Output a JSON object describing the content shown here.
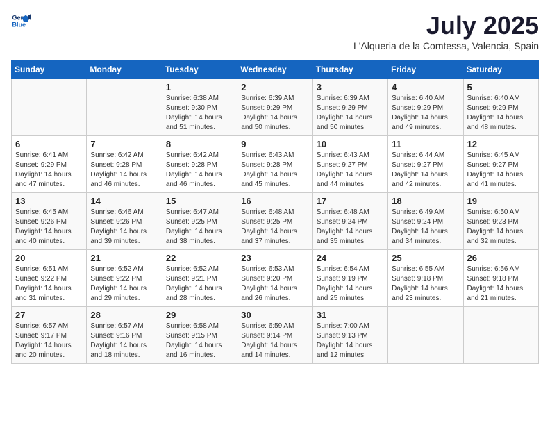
{
  "header": {
    "logo_line1": "General",
    "logo_line2": "Blue",
    "month": "July 2025",
    "location": "L'Alqueria de la Comtessa, Valencia, Spain"
  },
  "days_of_week": [
    "Sunday",
    "Monday",
    "Tuesday",
    "Wednesday",
    "Thursday",
    "Friday",
    "Saturday"
  ],
  "weeks": [
    [
      {
        "day": "",
        "info": ""
      },
      {
        "day": "",
        "info": ""
      },
      {
        "day": "1",
        "info": "Sunrise: 6:38 AM\nSunset: 9:30 PM\nDaylight: 14 hours\nand 51 minutes."
      },
      {
        "day": "2",
        "info": "Sunrise: 6:39 AM\nSunset: 9:29 PM\nDaylight: 14 hours\nand 50 minutes."
      },
      {
        "day": "3",
        "info": "Sunrise: 6:39 AM\nSunset: 9:29 PM\nDaylight: 14 hours\nand 50 minutes."
      },
      {
        "day": "4",
        "info": "Sunrise: 6:40 AM\nSunset: 9:29 PM\nDaylight: 14 hours\nand 49 minutes."
      },
      {
        "day": "5",
        "info": "Sunrise: 6:40 AM\nSunset: 9:29 PM\nDaylight: 14 hours\nand 48 minutes."
      }
    ],
    [
      {
        "day": "6",
        "info": "Sunrise: 6:41 AM\nSunset: 9:29 PM\nDaylight: 14 hours\nand 47 minutes."
      },
      {
        "day": "7",
        "info": "Sunrise: 6:42 AM\nSunset: 9:28 PM\nDaylight: 14 hours\nand 46 minutes."
      },
      {
        "day": "8",
        "info": "Sunrise: 6:42 AM\nSunset: 9:28 PM\nDaylight: 14 hours\nand 46 minutes."
      },
      {
        "day": "9",
        "info": "Sunrise: 6:43 AM\nSunset: 9:28 PM\nDaylight: 14 hours\nand 45 minutes."
      },
      {
        "day": "10",
        "info": "Sunrise: 6:43 AM\nSunset: 9:27 PM\nDaylight: 14 hours\nand 44 minutes."
      },
      {
        "day": "11",
        "info": "Sunrise: 6:44 AM\nSunset: 9:27 PM\nDaylight: 14 hours\nand 42 minutes."
      },
      {
        "day": "12",
        "info": "Sunrise: 6:45 AM\nSunset: 9:27 PM\nDaylight: 14 hours\nand 41 minutes."
      }
    ],
    [
      {
        "day": "13",
        "info": "Sunrise: 6:45 AM\nSunset: 9:26 PM\nDaylight: 14 hours\nand 40 minutes."
      },
      {
        "day": "14",
        "info": "Sunrise: 6:46 AM\nSunset: 9:26 PM\nDaylight: 14 hours\nand 39 minutes."
      },
      {
        "day": "15",
        "info": "Sunrise: 6:47 AM\nSunset: 9:25 PM\nDaylight: 14 hours\nand 38 minutes."
      },
      {
        "day": "16",
        "info": "Sunrise: 6:48 AM\nSunset: 9:25 PM\nDaylight: 14 hours\nand 37 minutes."
      },
      {
        "day": "17",
        "info": "Sunrise: 6:48 AM\nSunset: 9:24 PM\nDaylight: 14 hours\nand 35 minutes."
      },
      {
        "day": "18",
        "info": "Sunrise: 6:49 AM\nSunset: 9:24 PM\nDaylight: 14 hours\nand 34 minutes."
      },
      {
        "day": "19",
        "info": "Sunrise: 6:50 AM\nSunset: 9:23 PM\nDaylight: 14 hours\nand 32 minutes."
      }
    ],
    [
      {
        "day": "20",
        "info": "Sunrise: 6:51 AM\nSunset: 9:22 PM\nDaylight: 14 hours\nand 31 minutes."
      },
      {
        "day": "21",
        "info": "Sunrise: 6:52 AM\nSunset: 9:22 PM\nDaylight: 14 hours\nand 29 minutes."
      },
      {
        "day": "22",
        "info": "Sunrise: 6:52 AM\nSunset: 9:21 PM\nDaylight: 14 hours\nand 28 minutes."
      },
      {
        "day": "23",
        "info": "Sunrise: 6:53 AM\nSunset: 9:20 PM\nDaylight: 14 hours\nand 26 minutes."
      },
      {
        "day": "24",
        "info": "Sunrise: 6:54 AM\nSunset: 9:19 PM\nDaylight: 14 hours\nand 25 minutes."
      },
      {
        "day": "25",
        "info": "Sunrise: 6:55 AM\nSunset: 9:18 PM\nDaylight: 14 hours\nand 23 minutes."
      },
      {
        "day": "26",
        "info": "Sunrise: 6:56 AM\nSunset: 9:18 PM\nDaylight: 14 hours\nand 21 minutes."
      }
    ],
    [
      {
        "day": "27",
        "info": "Sunrise: 6:57 AM\nSunset: 9:17 PM\nDaylight: 14 hours\nand 20 minutes."
      },
      {
        "day": "28",
        "info": "Sunrise: 6:57 AM\nSunset: 9:16 PM\nDaylight: 14 hours\nand 18 minutes."
      },
      {
        "day": "29",
        "info": "Sunrise: 6:58 AM\nSunset: 9:15 PM\nDaylight: 14 hours\nand 16 minutes."
      },
      {
        "day": "30",
        "info": "Sunrise: 6:59 AM\nSunset: 9:14 PM\nDaylight: 14 hours\nand 14 minutes."
      },
      {
        "day": "31",
        "info": "Sunrise: 7:00 AM\nSunset: 9:13 PM\nDaylight: 14 hours\nand 12 minutes."
      },
      {
        "day": "",
        "info": ""
      },
      {
        "day": "",
        "info": ""
      }
    ]
  ]
}
